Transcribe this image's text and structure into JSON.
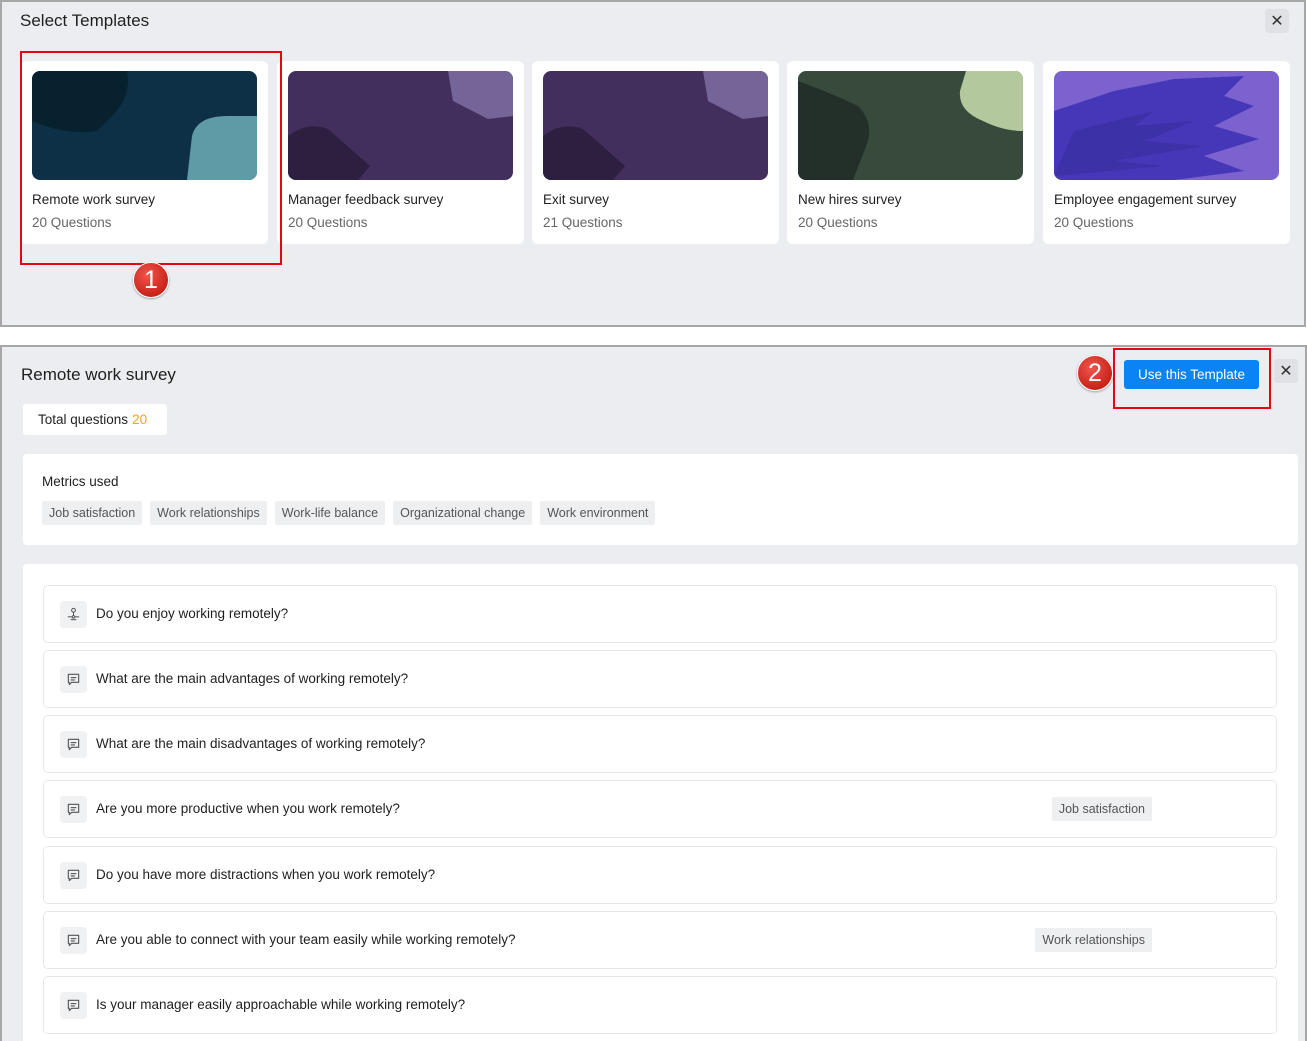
{
  "templates_dialog": {
    "title": "Select Templates",
    "close_icon": "close-icon",
    "cards": [
      {
        "name": "Remote work survey",
        "count": "20 Questions",
        "theme": "teal"
      },
      {
        "name": "Manager feedback survey",
        "count": "20 Questions",
        "theme": "purple"
      },
      {
        "name": "Exit survey",
        "count": "21 Questions",
        "theme": "purple"
      },
      {
        "name": "New hires survey",
        "count": "20 Questions",
        "theme": "green"
      },
      {
        "name": "Employee engagement survey",
        "count": "20 Questions",
        "theme": "violet"
      }
    ],
    "step_badge": "1"
  },
  "detail": {
    "title": "Remote work survey",
    "total_label": "Total questions",
    "total_value": "20",
    "use_button": "Use this Template",
    "step_badge": "2",
    "close_icon": "close-icon",
    "metrics_label": "Metrics used",
    "metrics": [
      "Job satisfaction",
      "Work relationships",
      "Work-life balance",
      "Organizational change",
      "Work environment"
    ],
    "questions": [
      {
        "text": "Do you enjoy working remotely?",
        "icon": "rating-scale-icon",
        "tag": ""
      },
      {
        "text": "What are the main advantages of working remotely?",
        "icon": "comment-icon",
        "tag": ""
      },
      {
        "text": "What are the main disadvantages of working remotely?",
        "icon": "comment-icon",
        "tag": ""
      },
      {
        "text": "Are you more productive when you work remotely?",
        "icon": "comment-icon",
        "tag": "Job satisfaction"
      },
      {
        "text": "Do you have more distractions when you work remotely?",
        "icon": "comment-icon",
        "tag": ""
      },
      {
        "text": "Are you able to connect with your team easily while working remotely?",
        "icon": "comment-icon",
        "tag": "Work relationships"
      },
      {
        "text": "Is your manager easily approachable while working remotely?",
        "icon": "comment-icon",
        "tag": ""
      }
    ]
  },
  "colors": {
    "accent": "#0a84f2",
    "highlight": "#e30613",
    "count_accent": "#f5a11b",
    "panel_bg": "#ebedf1"
  }
}
